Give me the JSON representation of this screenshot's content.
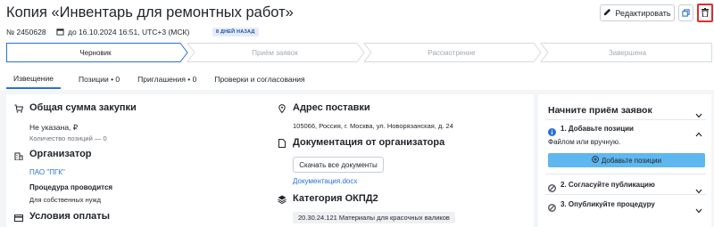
{
  "header": {
    "title": "Копия «Инвентарь для ремонтных работ»",
    "edit_label": "Редактировать",
    "number": "№ 2450628",
    "deadline": "до 16.10.2024 16:51, UTC+3 (МСК)",
    "badge": "8 ДНЕЙ НАЗАД",
    "delete_highlight_color": "#e02b2b"
  },
  "stepper": {
    "steps": [
      "Черновик",
      "Приём заявок",
      "Рассмотрение",
      "Завершена"
    ],
    "active_index": 0
  },
  "tabs": [
    "Извещение",
    "Позиции • 0",
    "Приглашения • 0",
    "Проверки и согласования"
  ],
  "left": {
    "amount_heading": "Общая сумма закупки",
    "amount_value": "Не указана, ₽",
    "positions_count": "Количество позиций — 0",
    "organizer_heading": "Организатор",
    "organizer_name": "ПАО \"ПГК\"",
    "procedure_label": "Процедура проводится",
    "procedure_value": "Для собственных нужд",
    "payment_heading": "Условия оплаты"
  },
  "middle": {
    "address_heading": "Адрес поставки",
    "address_value": "105066, Россия, г. Москва, ул. Новорязанская, д. 24",
    "docs_heading": "Документация от организатора",
    "download_label": "Скачать все документы",
    "doc_link": "Документация.docx",
    "okpd_heading": "Категория ОКПД2",
    "okpd_value": "20.30.24.121 Материалы для красочных валиков"
  },
  "side": {
    "title": "Начните приём заявок",
    "step1_title": "1. Добавьте позиции",
    "step1_desc": "Файлом или вручную.",
    "add_label": "Добавьте позиции",
    "step2_title": "2. Согласуйте публикацию",
    "step3_title": "3. Опубликуйте процедуру",
    "accent_color": "#5fb7ef"
  }
}
